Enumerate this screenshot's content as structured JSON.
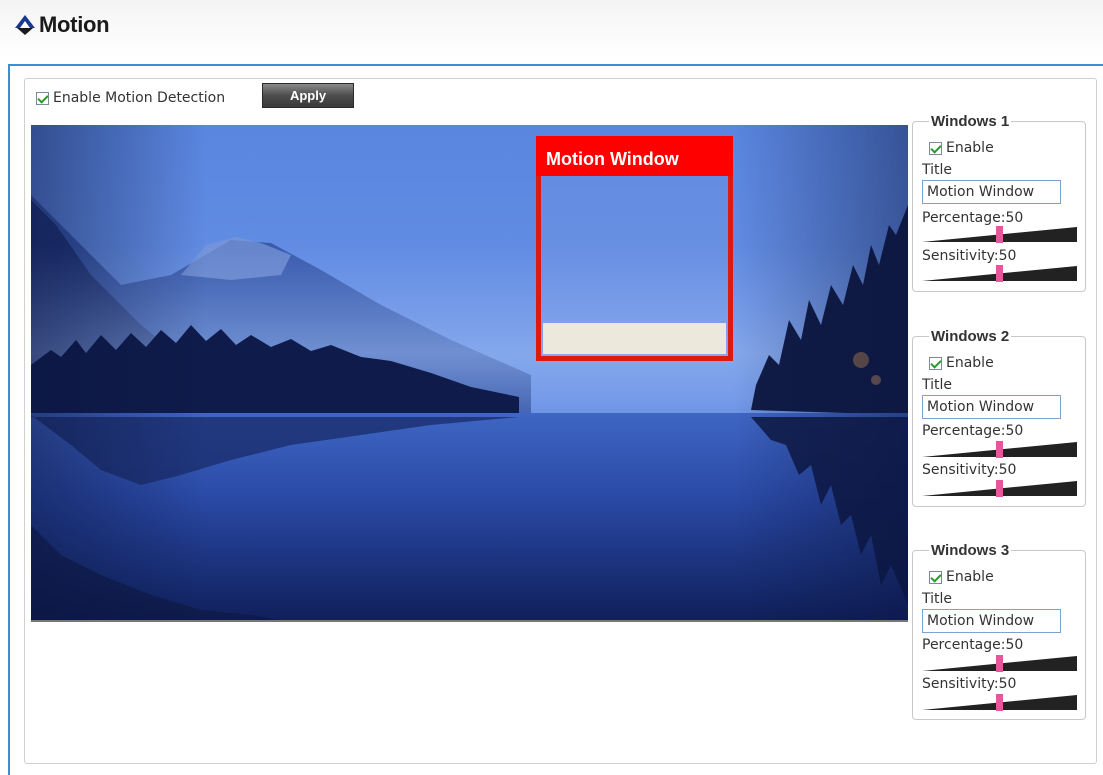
{
  "header": {
    "title": "Motion"
  },
  "controls": {
    "enable_label": "Enable Motion Detection",
    "enable_checked": true,
    "apply_label": "Apply"
  },
  "preview": {
    "motion_window_title": "Motion Window"
  },
  "windows": [
    {
      "legend": "Windows 1",
      "enable_label": "Enable",
      "enabled": true,
      "title_label": "Title",
      "title_value": "Motion Window",
      "percentage_label": "Percentage:50",
      "percentage": 50,
      "sensitivity_label": "Sensitivity:50",
      "sensitivity": 50
    },
    {
      "legend": "Windows 2",
      "enable_label": "Enable",
      "enabled": true,
      "title_label": "Title",
      "title_value": "Motion Window",
      "percentage_label": "Percentage:50",
      "percentage": 50,
      "sensitivity_label": "Sensitivity:50",
      "sensitivity": 50
    },
    {
      "legend": "Windows 3",
      "enable_label": "Enable",
      "enabled": true,
      "title_label": "Title",
      "title_value": "Motion Window",
      "percentage_label": "Percentage:50",
      "percentage": 50,
      "sensitivity_label": "Sensitivity:50",
      "sensitivity": 50
    }
  ],
  "colors": {
    "accent": "#3a8fd8",
    "motion_window": "#ff0000",
    "slider_thumb": "#e8559a"
  }
}
